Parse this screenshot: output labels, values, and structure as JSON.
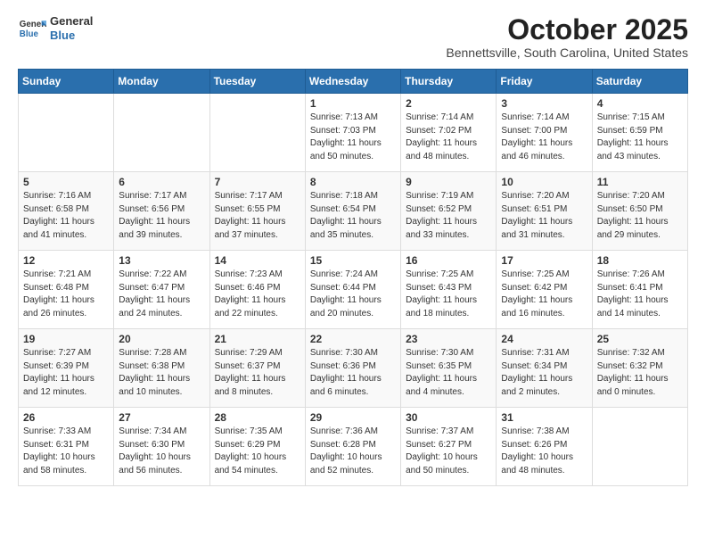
{
  "header": {
    "logo_general": "General",
    "logo_blue": "Blue",
    "month": "October 2025",
    "location": "Bennettsville, South Carolina, United States"
  },
  "days_of_week": [
    "Sunday",
    "Monday",
    "Tuesday",
    "Wednesday",
    "Thursday",
    "Friday",
    "Saturday"
  ],
  "weeks": [
    [
      {
        "day": "",
        "content": ""
      },
      {
        "day": "",
        "content": ""
      },
      {
        "day": "",
        "content": ""
      },
      {
        "day": "1",
        "content": "Sunrise: 7:13 AM\nSunset: 7:03 PM\nDaylight: 11 hours\nand 50 minutes."
      },
      {
        "day": "2",
        "content": "Sunrise: 7:14 AM\nSunset: 7:02 PM\nDaylight: 11 hours\nand 48 minutes."
      },
      {
        "day": "3",
        "content": "Sunrise: 7:14 AM\nSunset: 7:00 PM\nDaylight: 11 hours\nand 46 minutes."
      },
      {
        "day": "4",
        "content": "Sunrise: 7:15 AM\nSunset: 6:59 PM\nDaylight: 11 hours\nand 43 minutes."
      }
    ],
    [
      {
        "day": "5",
        "content": "Sunrise: 7:16 AM\nSunset: 6:58 PM\nDaylight: 11 hours\nand 41 minutes."
      },
      {
        "day": "6",
        "content": "Sunrise: 7:17 AM\nSunset: 6:56 PM\nDaylight: 11 hours\nand 39 minutes."
      },
      {
        "day": "7",
        "content": "Sunrise: 7:17 AM\nSunset: 6:55 PM\nDaylight: 11 hours\nand 37 minutes."
      },
      {
        "day": "8",
        "content": "Sunrise: 7:18 AM\nSunset: 6:54 PM\nDaylight: 11 hours\nand 35 minutes."
      },
      {
        "day": "9",
        "content": "Sunrise: 7:19 AM\nSunset: 6:52 PM\nDaylight: 11 hours\nand 33 minutes."
      },
      {
        "day": "10",
        "content": "Sunrise: 7:20 AM\nSunset: 6:51 PM\nDaylight: 11 hours\nand 31 minutes."
      },
      {
        "day": "11",
        "content": "Sunrise: 7:20 AM\nSunset: 6:50 PM\nDaylight: 11 hours\nand 29 minutes."
      }
    ],
    [
      {
        "day": "12",
        "content": "Sunrise: 7:21 AM\nSunset: 6:48 PM\nDaylight: 11 hours\nand 26 minutes."
      },
      {
        "day": "13",
        "content": "Sunrise: 7:22 AM\nSunset: 6:47 PM\nDaylight: 11 hours\nand 24 minutes."
      },
      {
        "day": "14",
        "content": "Sunrise: 7:23 AM\nSunset: 6:46 PM\nDaylight: 11 hours\nand 22 minutes."
      },
      {
        "day": "15",
        "content": "Sunrise: 7:24 AM\nSunset: 6:44 PM\nDaylight: 11 hours\nand 20 minutes."
      },
      {
        "day": "16",
        "content": "Sunrise: 7:25 AM\nSunset: 6:43 PM\nDaylight: 11 hours\nand 18 minutes."
      },
      {
        "day": "17",
        "content": "Sunrise: 7:25 AM\nSunset: 6:42 PM\nDaylight: 11 hours\nand 16 minutes."
      },
      {
        "day": "18",
        "content": "Sunrise: 7:26 AM\nSunset: 6:41 PM\nDaylight: 11 hours\nand 14 minutes."
      }
    ],
    [
      {
        "day": "19",
        "content": "Sunrise: 7:27 AM\nSunset: 6:39 PM\nDaylight: 11 hours\nand 12 minutes."
      },
      {
        "day": "20",
        "content": "Sunrise: 7:28 AM\nSunset: 6:38 PM\nDaylight: 11 hours\nand 10 minutes."
      },
      {
        "day": "21",
        "content": "Sunrise: 7:29 AM\nSunset: 6:37 PM\nDaylight: 11 hours\nand 8 minutes."
      },
      {
        "day": "22",
        "content": "Sunrise: 7:30 AM\nSunset: 6:36 PM\nDaylight: 11 hours\nand 6 minutes."
      },
      {
        "day": "23",
        "content": "Sunrise: 7:30 AM\nSunset: 6:35 PM\nDaylight: 11 hours\nand 4 minutes."
      },
      {
        "day": "24",
        "content": "Sunrise: 7:31 AM\nSunset: 6:34 PM\nDaylight: 11 hours\nand 2 minutes."
      },
      {
        "day": "25",
        "content": "Sunrise: 7:32 AM\nSunset: 6:32 PM\nDaylight: 11 hours\nand 0 minutes."
      }
    ],
    [
      {
        "day": "26",
        "content": "Sunrise: 7:33 AM\nSunset: 6:31 PM\nDaylight: 10 hours\nand 58 minutes."
      },
      {
        "day": "27",
        "content": "Sunrise: 7:34 AM\nSunset: 6:30 PM\nDaylight: 10 hours\nand 56 minutes."
      },
      {
        "day": "28",
        "content": "Sunrise: 7:35 AM\nSunset: 6:29 PM\nDaylight: 10 hours\nand 54 minutes."
      },
      {
        "day": "29",
        "content": "Sunrise: 7:36 AM\nSunset: 6:28 PM\nDaylight: 10 hours\nand 52 minutes."
      },
      {
        "day": "30",
        "content": "Sunrise: 7:37 AM\nSunset: 6:27 PM\nDaylight: 10 hours\nand 50 minutes."
      },
      {
        "day": "31",
        "content": "Sunrise: 7:38 AM\nSunset: 6:26 PM\nDaylight: 10 hours\nand 48 minutes."
      },
      {
        "day": "",
        "content": ""
      }
    ]
  ]
}
